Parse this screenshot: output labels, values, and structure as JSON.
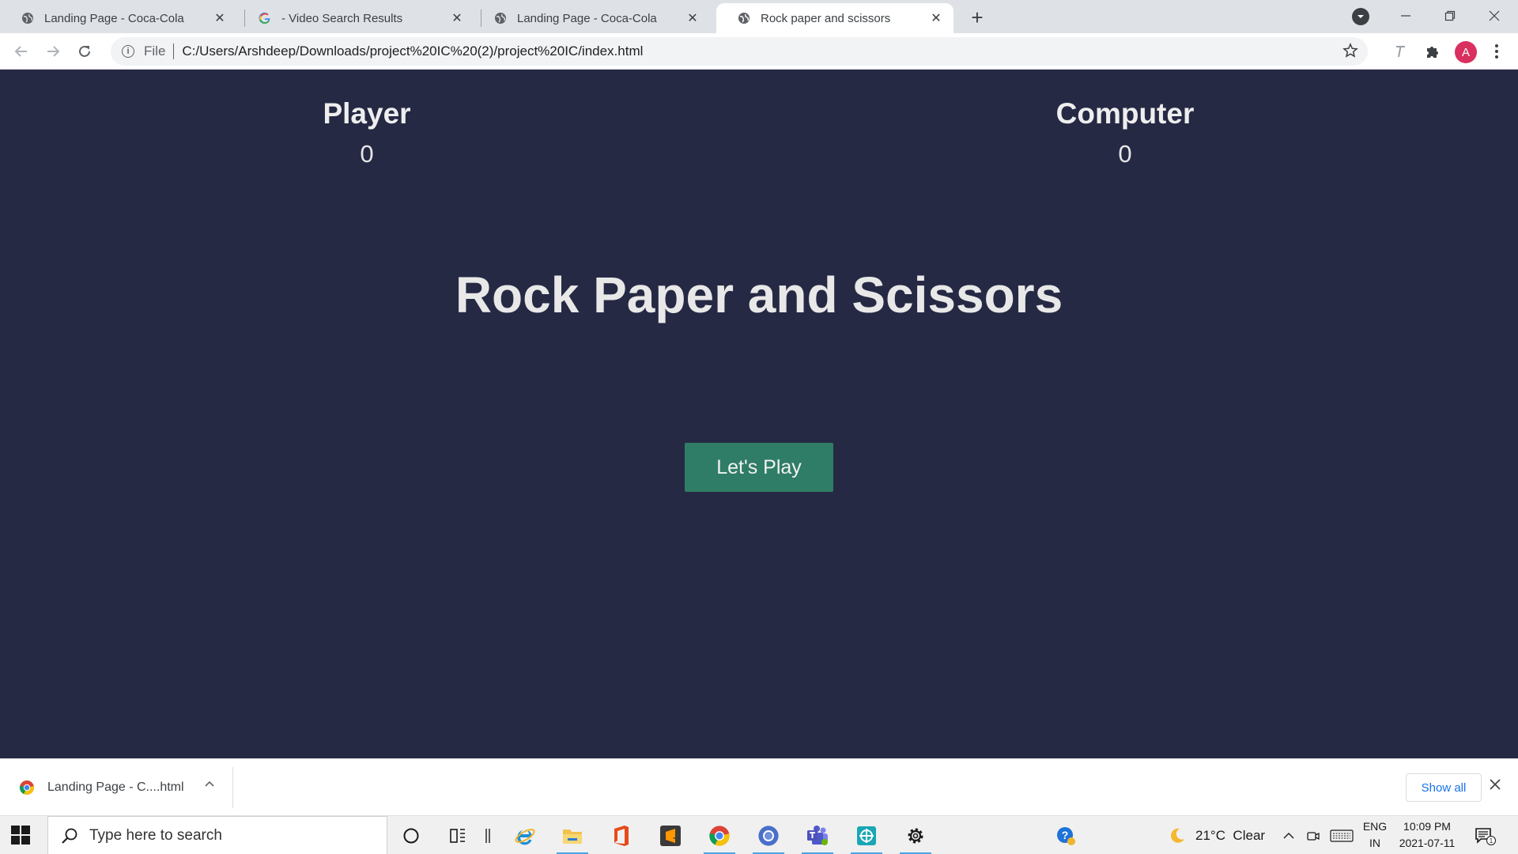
{
  "browser": {
    "tabs": [
      {
        "title": "Landing Page - Coca-Cola",
        "favicon": "globe-icon",
        "active": false
      },
      {
        "title": "- Video Search Results",
        "favicon": "google-icon",
        "active": false
      },
      {
        "title": "Landing Page - Coca-Cola",
        "favicon": "globe-icon",
        "active": false
      },
      {
        "title": "Rock paper and scissors",
        "favicon": "globe-icon",
        "active": true
      }
    ],
    "address": {
      "scheme_label": "File",
      "url": "C:/Users/Arshdeep/Downloads/project%20IC%20(2)/project%20IC/index.html"
    },
    "profile_initial": "A"
  },
  "game": {
    "player_label": "Player",
    "player_score": "0",
    "computer_label": "Computer",
    "computer_score": "0",
    "title": "Rock Paper and Scissors",
    "play_button": "Let's Play"
  },
  "download_bar": {
    "item_label": "Landing Page - C....html",
    "show_all": "Show all"
  },
  "taskbar": {
    "search_placeholder": "Type here to search",
    "weather": "21°C  Clear",
    "lang_top": "ENG",
    "lang_bottom": "IN",
    "time": "10:09 PM",
    "date": "2021-07-11",
    "notification_count": "1"
  },
  "colors": {
    "page_background": "#262944",
    "play_button": "#2f7d66",
    "tabstrip": "#dee1e6"
  }
}
